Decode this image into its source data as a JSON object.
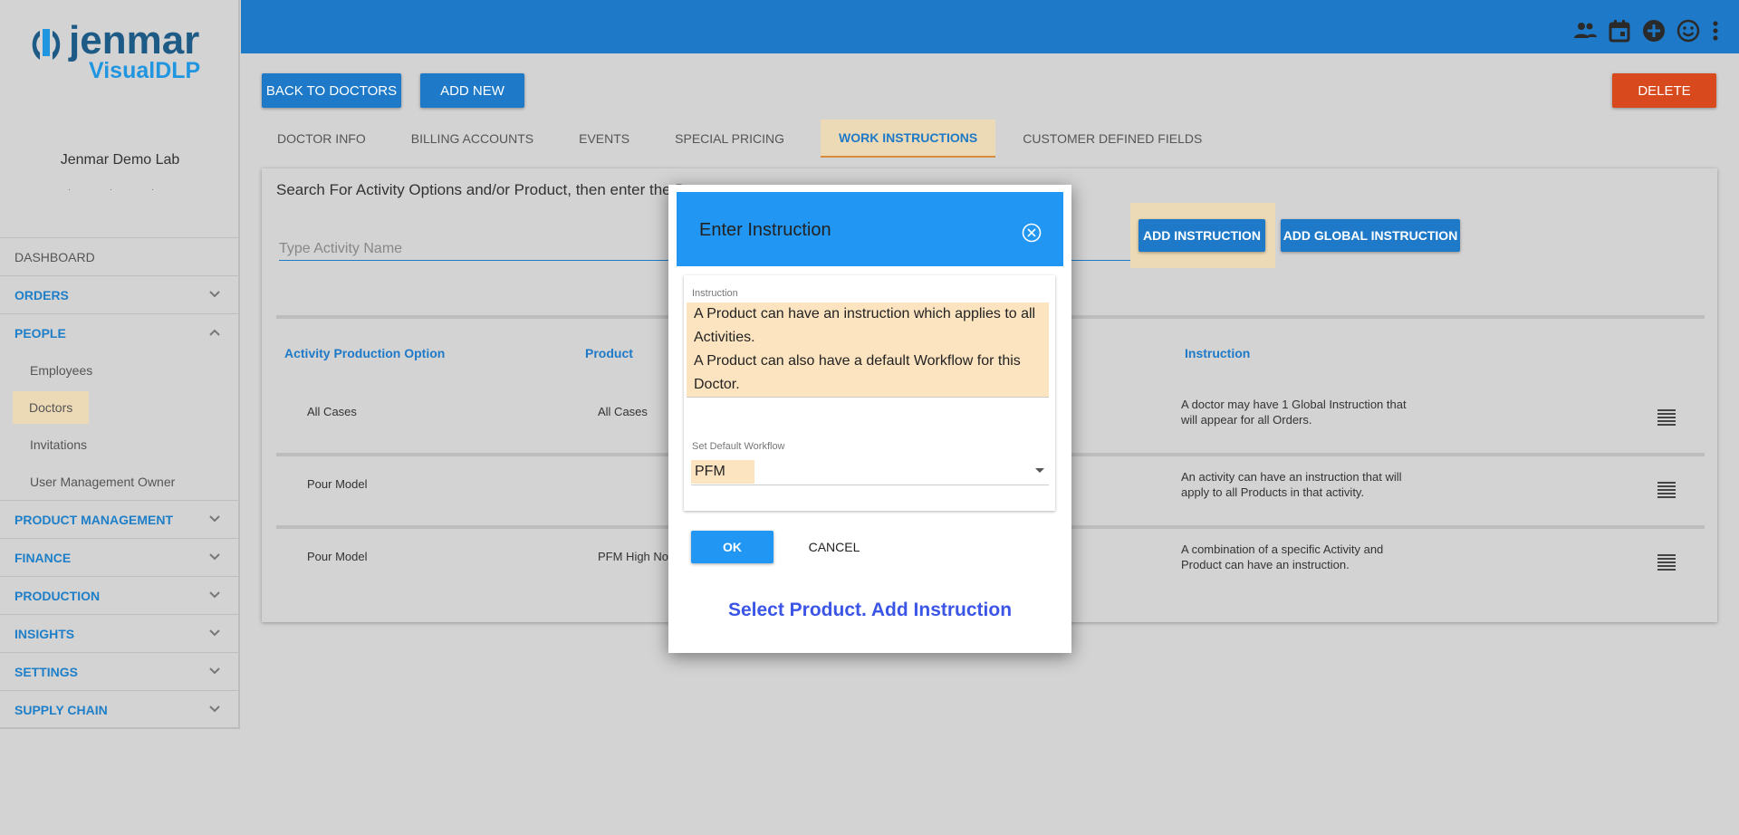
{
  "brand": {
    "name": "jenmar",
    "subname": "VisualDLP"
  },
  "lab": {
    "name": "Jenmar Demo Lab",
    "dots": "· · ·"
  },
  "sidebar": {
    "items": [
      {
        "label": "DASHBOARD"
      },
      {
        "label": "ORDERS"
      },
      {
        "label": "PEOPLE"
      },
      {
        "label": "PRODUCT MANAGEMENT"
      },
      {
        "label": "FINANCE"
      },
      {
        "label": "PRODUCTION"
      },
      {
        "label": "INSIGHTS"
      },
      {
        "label": "SETTINGS"
      },
      {
        "label": "SUPPLY CHAIN"
      }
    ],
    "people_sub": [
      "Employees",
      "Doctors",
      "Invitations",
      "User Management Owner"
    ]
  },
  "topbar": {
    "icons": [
      "people-icon",
      "calendar-icon",
      "add-circle-icon",
      "smiley-icon",
      "more-vert-icon"
    ]
  },
  "toolbar": {
    "back_label": "BACK TO DOCTORS",
    "add_new_label": "ADD NEW",
    "delete_label": "DELETE"
  },
  "tabs": [
    "DOCTOR INFO",
    "BILLING ACCOUNTS",
    "EVENTS",
    "SPECIAL PRICING",
    "WORK INSTRUCTIONS",
    "CUSTOMER DEFINED FIELDS"
  ],
  "main": {
    "hint": "Search For Activity Options and/or Product, then enter the D",
    "activity_placeholder": "Type Activity Name",
    "add_instruction_label": "ADD INSTRUCTION",
    "add_global_label": "ADD GLOBAL INSTRUCTION"
  },
  "table": {
    "headers": [
      "Activity Production Option",
      "Product",
      "Instruction"
    ],
    "rows": [
      {
        "activity": "All Cases",
        "product": "All Cases",
        "instruction": "A doctor may have 1 Global Instruction that will appear for all Orders."
      },
      {
        "activity": "Pour Model",
        "product": "",
        "instruction": "An activity can have an instruction that will apply to all Products in that activity."
      },
      {
        "activity": "Pour Model",
        "product": "PFM High No",
        "instruction": "A combination of a specific Activity and Product can have an instruction."
      }
    ]
  },
  "modal": {
    "title": "Enter Instruction",
    "instruction_label": "Instruction",
    "instruction_line1": "A Product can have an instruction which applies to all Activities.",
    "instruction_line2": "A Product can also have a default Workflow for this Doctor.",
    "workflow_label": "Set Default Workflow",
    "workflow_value": "PFM",
    "ok_label": "OK",
    "cancel_label": "CANCEL",
    "callout": "Select Product. Add Instruction"
  },
  "colors": {
    "primary": "#1e7ac8",
    "modal_header": "#2196f3",
    "danger": "#d84a1e",
    "highlight": "#ecd9b5",
    "callout": "#3b55e6"
  }
}
